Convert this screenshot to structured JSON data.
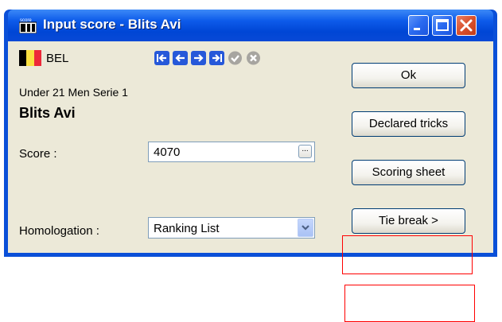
{
  "window": {
    "title": "Input score - Blits Avi",
    "app_icon_text": "score"
  },
  "player": {
    "country_code": "BEL",
    "flag_colors": [
      "#000000",
      "#fae042",
      "#ed2939"
    ],
    "category": "Under 21 Men Serie 1",
    "name": "Blits Avi"
  },
  "navigation": {
    "icons": [
      "first-arrow-icon",
      "previous-arrow-icon",
      "next-arrow-icon",
      "last-arrow-icon",
      "confirm-check-icon",
      "cancel-x-icon"
    ]
  },
  "form": {
    "score_label": "Score :",
    "score_value": "4070",
    "ellipsis_label": "...",
    "homologation_label": "Homologation :",
    "homologation_value": "Ranking List"
  },
  "buttons": {
    "ok": "Ok",
    "declared_tricks": "Declared tricks",
    "scoring_sheet": "Scoring sheet",
    "tie_break": "Tie break >"
  },
  "colors": {
    "title_bar": "#0a4fd8",
    "client_bg": "#ece9d8",
    "nav_arrow": "#2658d9",
    "disabled_icon": "#a7a5a0",
    "highlight_box": "#ff0000"
  }
}
